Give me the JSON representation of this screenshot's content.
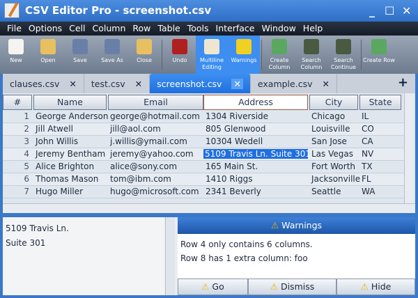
{
  "window": {
    "title": "CSV Editor Pro - screenshot.csv",
    "minimize": "_",
    "maximize": "☐",
    "close": "✕"
  },
  "menu": [
    "File",
    "Options",
    "Cell",
    "Column",
    "Row",
    "Table",
    "Tools",
    "Interface",
    "Window",
    "Help"
  ],
  "toolbar": [
    {
      "label": "New",
      "color": "#f4f4f0"
    },
    {
      "label": "Open",
      "color": "#e8c060"
    },
    {
      "label": "Save",
      "color": "#6a7fa8"
    },
    {
      "label": "Save As",
      "color": "#6a7fa8"
    },
    {
      "label": "Close",
      "color": "#e8c060"
    },
    {
      "sep": true
    },
    {
      "label": "Undo",
      "color": "#b02020"
    },
    {
      "label": "Multiline Editing",
      "color": "#f0e6d0",
      "active": true
    },
    {
      "label": "Warnings",
      "color": "#f0d020",
      "active": true
    },
    {
      "sep": true
    },
    {
      "label": "Create Column",
      "color": "#5aa860"
    },
    {
      "label": "Search Column",
      "color": "#4a5a40"
    },
    {
      "label": "Search Continue",
      "color": "#4a5a40"
    },
    {
      "sep": true
    },
    {
      "label": "Create Row",
      "color": "#5aa860"
    }
  ],
  "tabs": [
    {
      "label": "clauses.csv"
    },
    {
      "label": "test.csv"
    },
    {
      "label": "screenshot.csv",
      "selected": true
    },
    {
      "label": "example.csv"
    }
  ],
  "tab_close": "✕",
  "tab_add": "+",
  "columns": [
    "#",
    "Name",
    "Email",
    "Address",
    "City",
    "State"
  ],
  "rows": [
    [
      "1",
      "George Anderson",
      "george@hotmail.com",
      "1304 Riverside",
      "Chicago",
      "IL"
    ],
    [
      "2",
      "Jill Atwell",
      "jill@aol.com",
      "805 Glenwood",
      "Louisville",
      "CO"
    ],
    [
      "3",
      "John Willis",
      "j.willis@ymail.com",
      "10304 Wedell",
      "San Jose",
      "CA"
    ],
    [
      "4",
      "Jeremy Bentham",
      "jeremy@yahoo.com",
      "5109 Travis Ln. Suite 301",
      "Las Vegas",
      "NV"
    ],
    [
      "5",
      "Alice Brighton",
      "alice@sony.com",
      "165 Main St.",
      "Fort Worth",
      "TX"
    ],
    [
      "6",
      "Thomas Mason",
      "tom@ibm.com",
      "1410 Riggs",
      "Jacksonville",
      "FL"
    ],
    [
      "7",
      "Hugo Miller",
      "hugo@microsoft.com",
      "2341 Beverly",
      "Seattle",
      "WA"
    ]
  ],
  "selected_cell": {
    "row": 4,
    "column": "Address"
  },
  "editor": {
    "lines": [
      "5109 Travis Ln.",
      "Suite 301"
    ]
  },
  "warnings": {
    "title": "Warnings",
    "messages": [
      "Row 4 only contains 6 columns.",
      "Row 8 has 1 extra column: foo"
    ],
    "go": "Go",
    "dismiss": "Dismiss",
    "hide": "Hide",
    "icon": "⚠"
  }
}
